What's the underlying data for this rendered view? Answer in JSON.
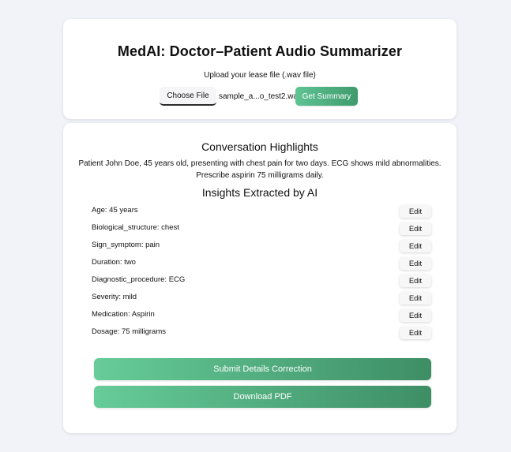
{
  "header": {
    "title": "MedAI: Doctor–Patient Audio Summarizer",
    "upload_label": "Upload your lease file (.wav file)",
    "choose_file_label": "Choose File",
    "file_name": "sample_a...o_test2.wav",
    "get_summary_label": "Get Summary"
  },
  "highlights": {
    "title": "Conversation Highlights",
    "line1": "Patient John Doe, 45 years old, presenting with chest pain for two days. ECG shows mild abnormalities.",
    "line2": "Prescribe aspirin 75 milligrams daily."
  },
  "insights": {
    "title": "Insights Extracted by AI",
    "edit_label": "Edit",
    "items": [
      {
        "label": "Age: 45 years"
      },
      {
        "label": "Biological_structure: chest"
      },
      {
        "label": "Sign_symptom: pain"
      },
      {
        "label": "Duration: two"
      },
      {
        "label": "Diagnostic_procedure: ECG"
      },
      {
        "label": "Severity: mild"
      },
      {
        "label": "Medication: Aspirin"
      },
      {
        "label": "Dosage: 75 milligrams"
      }
    ]
  },
  "actions": {
    "submit_label": "Submit Details Correction",
    "download_label": "Download PDF"
  },
  "colors": {
    "page_background": "#f1f3f8",
    "card_background": "#ffffff",
    "accent_start": "#66cc99",
    "accent_end": "#3e8e65"
  }
}
